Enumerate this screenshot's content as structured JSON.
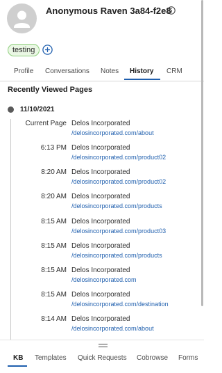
{
  "header": {
    "visitor_name": "Anonymous Raven 3a84-f2e8",
    "avatar_icon": "user-avatar-icon",
    "info_icon": "info-icon"
  },
  "tags": {
    "items": [
      "testing"
    ],
    "add_icon": "plus-circle-icon"
  },
  "tabs": [
    {
      "label": "Profile",
      "active": false
    },
    {
      "label": "Conversations",
      "active": false
    },
    {
      "label": "Notes",
      "active": false
    },
    {
      "label": "History",
      "active": true
    },
    {
      "label": "CRM",
      "active": false
    }
  ],
  "history": {
    "section_title": "Recently Viewed Pages",
    "date": "11/10/2021",
    "entries": [
      {
        "time": "Current Page",
        "title": "Delos Incorporated",
        "url": "/delosincorporated.com/about"
      },
      {
        "time": "6:13 PM",
        "title": "Delos Incorporated",
        "url": "/delosincorporated.com/product02"
      },
      {
        "time": "8:20 AM",
        "title": "Delos Incorporated",
        "url": "/delosincorporated.com/product02"
      },
      {
        "time": "8:20 AM",
        "title": "Delos Incorporated",
        "url": "/delosincorporated.com/products"
      },
      {
        "time": "8:15 AM",
        "title": "Delos Incorporated",
        "url": "/delosincorporated.com/product03"
      },
      {
        "time": "8:15 AM",
        "title": "Delos Incorporated",
        "url": "/delosincorporated.com/products"
      },
      {
        "time": "8:15 AM",
        "title": "Delos Incorporated",
        "url": "/delosincorporated.com"
      },
      {
        "time": "8:15 AM",
        "title": "Delos Incorporated",
        "url": "/delosincorporated.com/destination"
      },
      {
        "time": "8:14 AM",
        "title": "Delos Incorporated",
        "url": "/delosincorporated.com/about"
      }
    ]
  },
  "bottom_tabs": [
    {
      "label": "KB",
      "active": true
    },
    {
      "label": "Templates",
      "active": false
    },
    {
      "label": "Quick Requests",
      "active": false
    },
    {
      "label": "Cobrowse",
      "active": false
    },
    {
      "label": "Forms",
      "active": false
    }
  ],
  "colors": {
    "accent": "#1f5fae",
    "tag_border": "#8fd07e",
    "tag_background": "#eaf7e4"
  }
}
